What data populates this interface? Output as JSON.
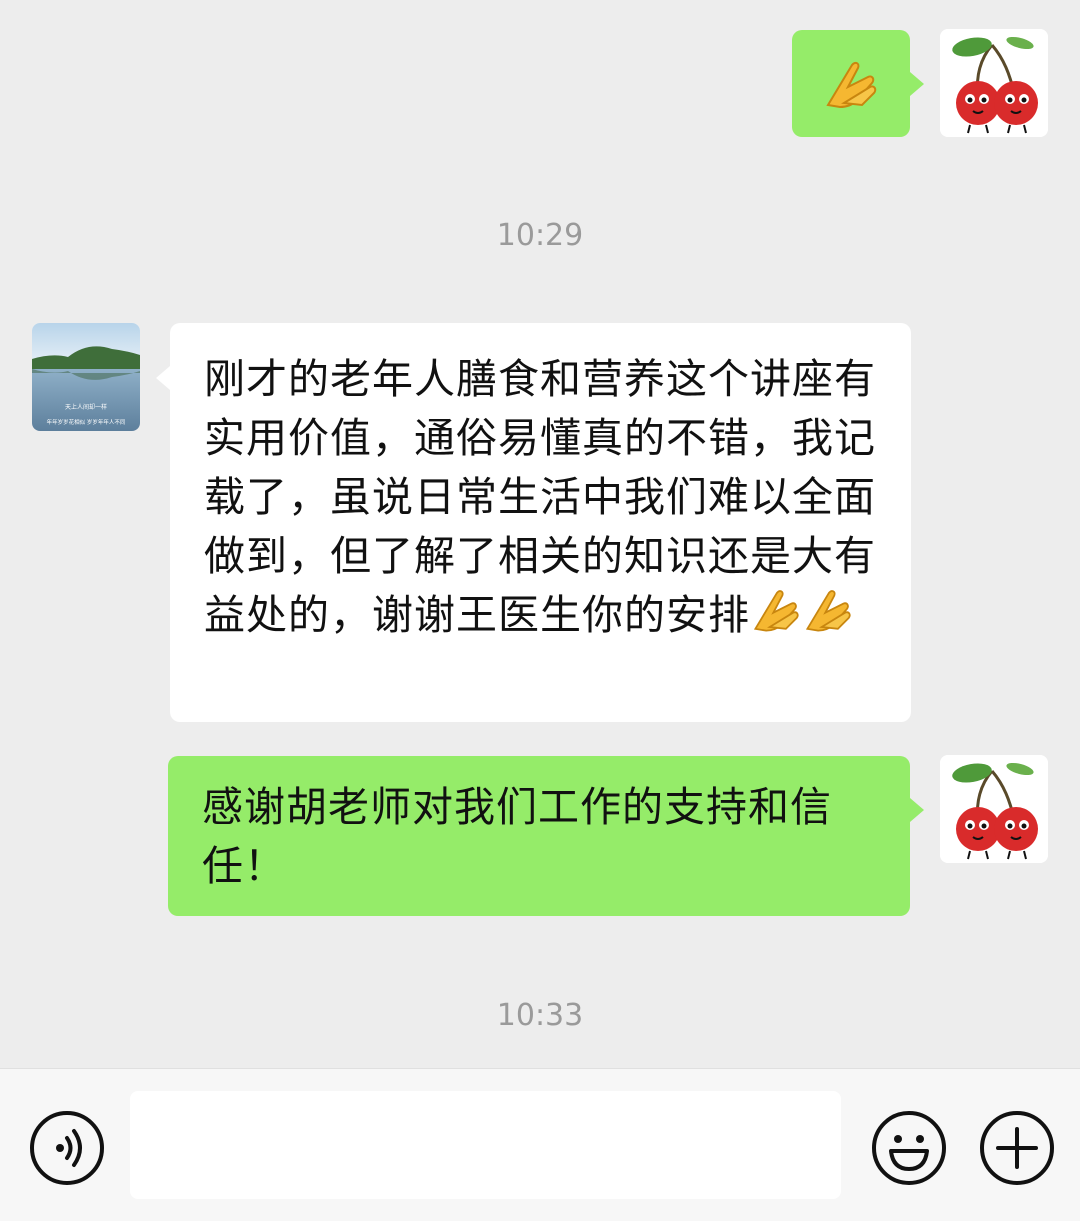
{
  "messages": [
    {
      "side": "right",
      "type": "emoji",
      "emoji": "folded-hands",
      "avatar": "cherry-avatar"
    },
    {
      "side": "left",
      "text": "刚才的老年人膳食和营养这个讲座有实用价值，通俗易懂真的不错，我记载了，虽说日常生活中我们难以全面做到，但了解了相关的知识还是大有益处的，谢谢王医生你的安排",
      "avatar": "lake-landscape-avatar",
      "trailing_emoji": [
        "folded-hands",
        "folded-hands"
      ]
    },
    {
      "side": "right",
      "text": "感谢胡老师对我们工作的支持和信任！",
      "avatar": "cherry-avatar"
    }
  ],
  "timestamps": [
    "10:29",
    "10:33"
  ],
  "avatar_left": {
    "caption_line1": "天上人间却一样",
    "caption_line2": "年年岁岁花相似 岁岁年年人不同"
  },
  "input": {
    "value": "",
    "placeholder": ""
  },
  "icons": {
    "voice": "voice-icon",
    "emoji": "smiley-icon",
    "plus": "plus-icon"
  },
  "colors": {
    "background": "#ededed",
    "self_bubble": "#95ec69",
    "other_bubble": "#ffffff",
    "timestamp": "#9a9a9a"
  }
}
